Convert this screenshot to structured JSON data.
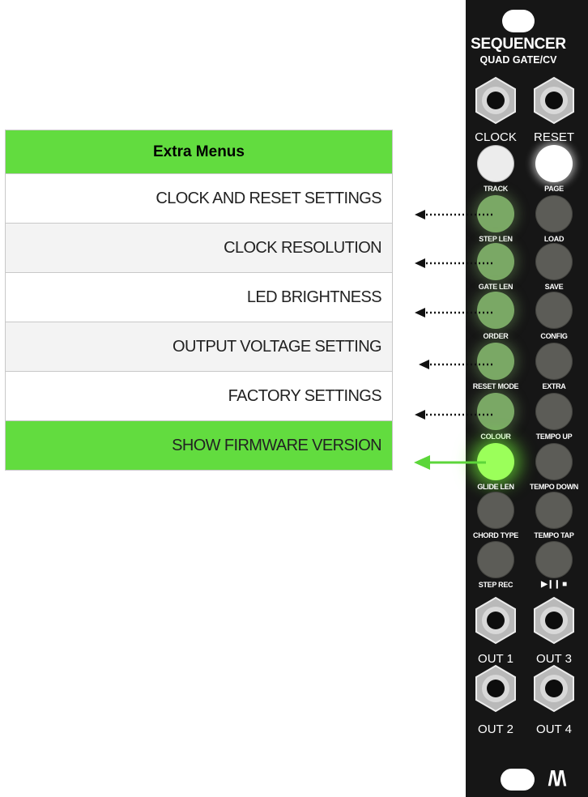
{
  "menu": {
    "header": "Extra Menus",
    "items": [
      {
        "label": "CLOCK AND RESET SETTINGS",
        "selected": false
      },
      {
        "label": "CLOCK RESOLUTION",
        "selected": false
      },
      {
        "label": "LED BRIGHTNESS",
        "selected": false
      },
      {
        "label": "OUTPUT VOLTAGE SETTING",
        "selected": false
      },
      {
        "label": "FACTORY SETTINGS",
        "selected": false
      },
      {
        "label": "SHOW FIRMWARE VERSION",
        "selected": true
      }
    ]
  },
  "module": {
    "title": "SEQUENCER",
    "subtitle": "QUAD GATE/CV",
    "jacks_top": [
      "CLOCK",
      "RESET"
    ],
    "buttons_left": [
      "TRACK",
      "STEP LEN",
      "GATE LEN",
      "ORDER",
      "RESET MODE",
      "COLOUR",
      "GLIDE LEN",
      "CHORD TYPE",
      "STEP REC"
    ],
    "buttons_right": [
      "PAGE",
      "LOAD",
      "SAVE",
      "CONFIG",
      "EXTRA",
      "TEMPO UP",
      "TEMPO DOWN",
      "TEMPO TAP",
      "▶❙❙ ■"
    ],
    "jacks_bottom": [
      "OUT 1",
      "OUT 3",
      "OUT 2",
      "OUT 4"
    ],
    "logo_text": "/\\/\\"
  },
  "colors": {
    "accent_green": "#62dc3f",
    "panel_black": "#161616",
    "lit_button": "#9bff5a",
    "dim_green_button": "#7aa865",
    "grey_button": "#5c5c57"
  }
}
